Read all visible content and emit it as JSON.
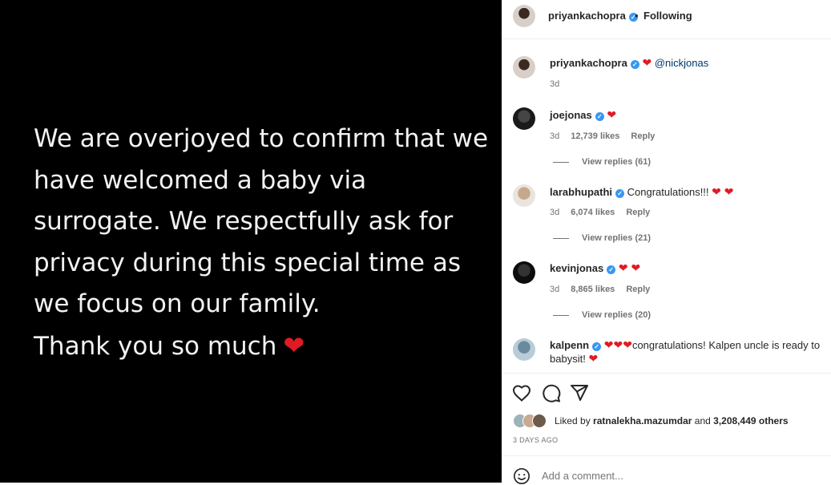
{
  "post": {
    "lines": [
      "We are overjoyed to confirm that we",
      "have welcomed a baby via",
      "surrogate. We respectfully ask for",
      "privacy during this special time as",
      "we focus on our family.",
      "Thank you so much"
    ],
    "heart": "❤"
  },
  "header": {
    "username": "priyankachopra",
    "verified_mark": "✓",
    "separator": "•",
    "follow_status": "Following"
  },
  "caption": {
    "username": "priyankachopra",
    "heart": "❤",
    "mention": "@nickjonas",
    "time": "3d"
  },
  "comments": [
    {
      "username": "joejonas",
      "text": "",
      "hearts": "❤",
      "time": "3d",
      "likes": "12,739 likes",
      "reply": "Reply",
      "view_replies": "View replies (61)"
    },
    {
      "username": "larabhupathi",
      "text": "Congratulations!!!",
      "hearts": "❤ ❤",
      "time": "3d",
      "likes": "6,074 likes",
      "reply": "Reply",
      "view_replies": "View replies (21)"
    },
    {
      "username": "kevinjonas",
      "text": "",
      "hearts": "❤ ❤",
      "time": "3d",
      "likes": "8,865 likes",
      "reply": "Reply",
      "view_replies": "View replies (20)"
    },
    {
      "username": "kalpenn",
      "hearts": "❤❤❤",
      "text_line1": "congratulations! Kalpen uncle is ready to",
      "text_line2": "babysit!",
      "heart_end": "❤"
    }
  ],
  "likes": {
    "prefix": "Liked by",
    "user": "ratnalekha.mazumdar",
    "middle": "and",
    "others": "3,208,449 others"
  },
  "post_date": "3 DAYS AGO",
  "add_comment": {
    "placeholder": "Add a comment..."
  },
  "icons": [
    "heart-icon",
    "comment-icon",
    "share-icon",
    "emoji-icon",
    "verified-icon"
  ]
}
